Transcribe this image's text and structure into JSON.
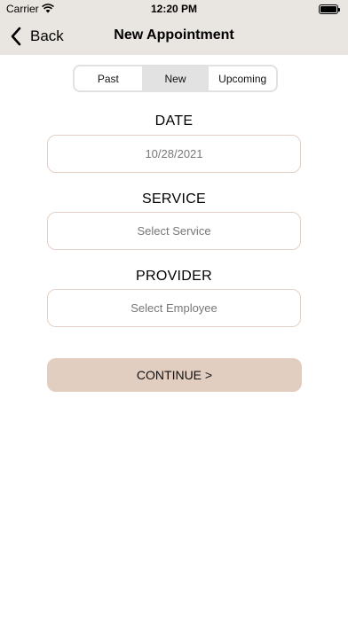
{
  "status_bar": {
    "carrier": "Carrier",
    "time": "12:20 PM"
  },
  "nav": {
    "back_label": "Back",
    "title": "New Appointment"
  },
  "segments": [
    {
      "label": "Past",
      "active": false
    },
    {
      "label": "New",
      "active": true
    },
    {
      "label": "Upcoming",
      "active": false
    }
  ],
  "form": {
    "date_label": "DATE",
    "date_value": "10/28/2021",
    "service_label": "SERVICE",
    "service_placeholder": "Select Service",
    "provider_label": "PROVIDER",
    "provider_placeholder": "Select Employee"
  },
  "continue_label": "CONTINUE >",
  "colors": {
    "header_bg": "#e9e5e0",
    "field_border": "#e3d0c5",
    "button_bg": "#e2cdc1"
  }
}
